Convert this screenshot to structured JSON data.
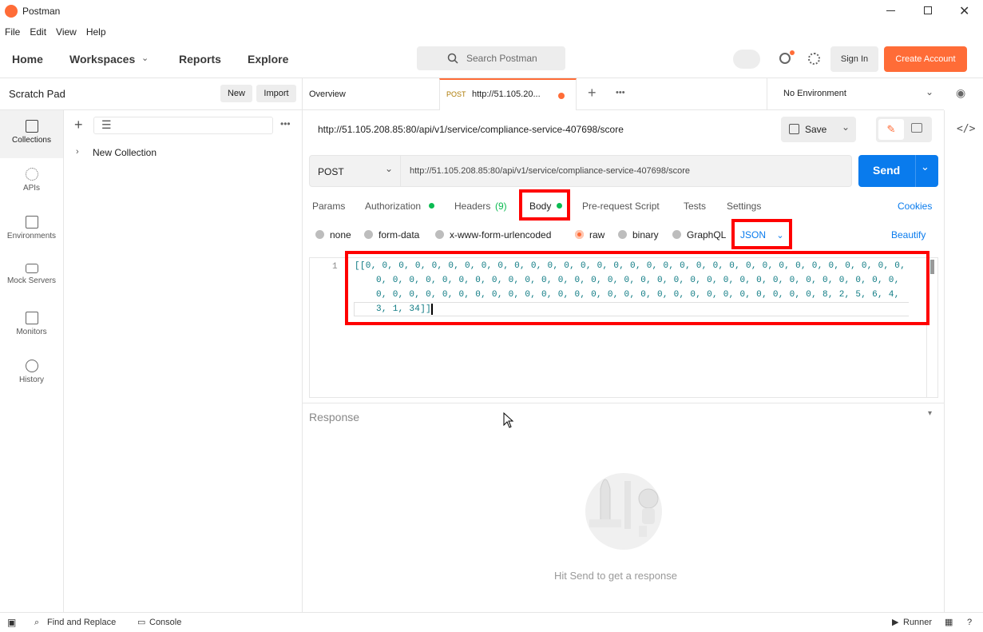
{
  "app": {
    "title": "Postman",
    "menu": [
      "File",
      "Edit",
      "View",
      "Help"
    ]
  },
  "header": {
    "home": "Home",
    "workspaces": "Workspaces",
    "reports": "Reports",
    "explore": "Explore",
    "search_placeholder": "Search Postman",
    "sign_in": "Sign In",
    "create_account": "Create Account"
  },
  "sidebar": {
    "title": "Scratch Pad",
    "new": "New",
    "import": "Import",
    "collection": "New Collection",
    "rail": [
      {
        "label": "Collections"
      },
      {
        "label": "APIs"
      },
      {
        "label": "Environments"
      },
      {
        "label": "Mock Servers"
      },
      {
        "label": "Monitors"
      },
      {
        "label": "History"
      }
    ]
  },
  "tabs": {
    "overview": "Overview",
    "active_method": "POST",
    "active_url": "http://51.105.20...",
    "environment": "No Environment"
  },
  "request": {
    "title": "http://51.105.208.85:80/api/v1/service/compliance-service-407698/score",
    "save": "Save",
    "method": "POST",
    "url": "http://51.105.208.85:80/api/v1/service/compliance-service-407698/score",
    "send": "Send"
  },
  "reqtabs": {
    "params": "Params",
    "authorization": "Authorization",
    "headers": "Headers",
    "headers_count": "(9)",
    "body": "Body",
    "prerequest": "Pre-request Script",
    "tests": "Tests",
    "settings": "Settings",
    "cookies": "Cookies"
  },
  "bodytypes": {
    "none": "none",
    "formdata": "form-data",
    "urlencoded": "x-www-form-urlencoded",
    "raw": "raw",
    "binary": "binary",
    "graphql": "GraphQL",
    "format": "JSON",
    "beautify": "Beautify"
  },
  "editor": {
    "line_number": "1",
    "line1": "[[0, 0, 0, 0, 0, 0, 0, 0, 0, 0, 0, 0, 0, 0, 0, 0, 0, 0, 0, 0, 0, 0, 0, 0, 0, 0, 0, 0, 0, 0, 0, 0, 0,",
    "line2": "0, 0, 0, 0, 0, 0, 0, 0, 0, 0, 0, 0, 0, 0, 0, 0, 0, 0, 0, 0, 0, 0, 0, 0, 0, 0, 0, 0, 0, 0, 0, 0,",
    "line3": "0, 0, 0, 0, 0, 0, 0, 0, 0, 0, 0, 0, 0, 0, 0, 0, 0, 0, 0, 0, 0, 0, 0, 0, 0, 0, 0, 8, 2, 5, 6, 4,",
    "line4": "3, 1, 34]]"
  },
  "response": {
    "label": "Response",
    "hint": "Hit Send to get a response"
  },
  "footer": {
    "find": "Find and Replace",
    "console": "Console",
    "runner": "Runner"
  },
  "colors": {
    "accent": "#ff6c37",
    "send": "#097bed",
    "highlight": "#ff0000",
    "green_dot": "#0cbb52"
  }
}
